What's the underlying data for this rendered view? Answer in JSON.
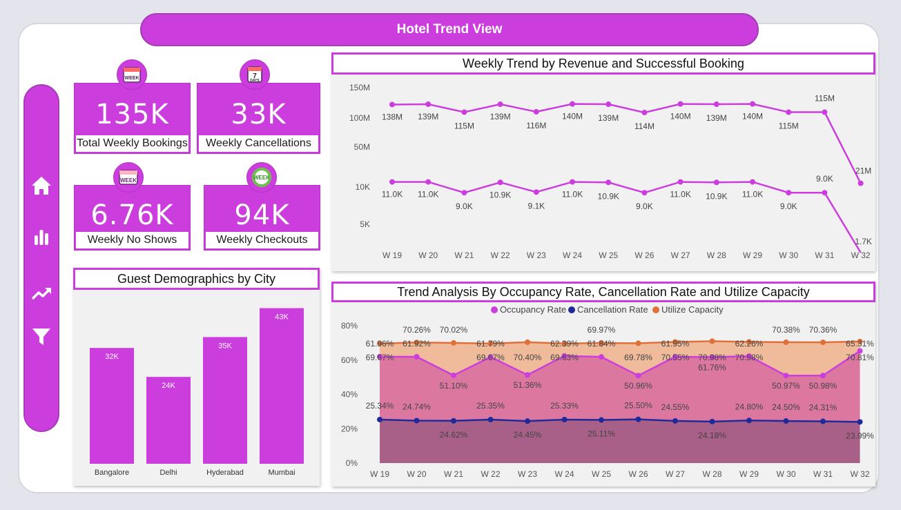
{
  "page_title": "Hotel Trend View",
  "nav": [
    "home-icon",
    "bar-chart-icon",
    "trend-icon",
    "filter-icon"
  ],
  "kpis": [
    {
      "value": "135K",
      "label": "Total Weekly Bookings",
      "icon": "week-calendar-icon"
    },
    {
      "value": "33K",
      "label": "Weekly Cancellations",
      "icon": "seven-days-calendar-icon"
    },
    {
      "value": "6.76K",
      "label": "Weekly No Shows",
      "icon": "week-calendar-icon"
    },
    {
      "value": "94K",
      "label": "Weekly Checkouts",
      "icon": "week-refresh-icon"
    }
  ],
  "colors": {
    "accent": "#cb3ddd",
    "occupancy": "#cb3ddd",
    "cancellation": "#1f2a9a",
    "utilize": "#e0703a"
  },
  "chart_data": [
    {
      "type": "line",
      "title": "Weekly Trend by Revenue and Successful Booking",
      "log_scale": true,
      "grid": false,
      "x": [
        "W 19",
        "W 20",
        "W 21",
        "W 22",
        "W 23",
        "W 24",
        "W 25",
        "W 26",
        "W 27",
        "W 28",
        "W 29",
        "W 30",
        "W 31",
        "W 32"
      ],
      "y_ticks": [
        "150M",
        "100M",
        "50M",
        "10K",
        "5K"
      ],
      "series": [
        {
          "values": [
            138,
            139,
            115,
            139,
            116,
            140,
            139,
            114,
            140,
            139,
            140,
            115,
            115,
            21
          ],
          "labels": [
            "138M",
            "139M",
            "115M",
            "139M",
            "116M",
            "140M",
            "139M",
            "114M",
            "140M",
            "139M",
            "140M",
            "115M",
            "115M",
            "21M"
          ]
        },
        {
          "values": [
            11.0,
            11.0,
            9.0,
            10.9,
            9.1,
            11.0,
            10.9,
            9.0,
            11.0,
            10.9,
            11.0,
            9.0,
            9.0,
            1.7
          ],
          "labels": [
            "11.0K",
            "11.0K",
            "9.0K",
            "10.9K",
            "9.1K",
            "11.0K",
            "10.9K",
            "9.0K",
            "11.0K",
            "10.9K",
            "11.0K",
            "9.0K",
            "9.0K",
            "1.7K"
          ]
        }
      ]
    },
    {
      "type": "bar",
      "title": "Guest Demographics by City",
      "categories": [
        "Bangalore",
        "Delhi",
        "Hyderabad",
        "Mumbai"
      ],
      "values": [
        32,
        24,
        35,
        43
      ],
      "labels": [
        "32K",
        "24K",
        "35K",
        "43K"
      ],
      "ylim": [
        0,
        45
      ]
    },
    {
      "type": "area",
      "title": "Trend Analysis By Occupancy Rate, Cancellation Rate and Utilize Capacity",
      "legend_position": "top",
      "x": [
        "W 19",
        "W 20",
        "W 21",
        "W 22",
        "W 23",
        "W 24",
        "W 25",
        "W 26",
        "W 27",
        "W 28",
        "W 29",
        "W 30",
        "W 31",
        "W 32"
      ],
      "y_ticks": [
        "80%",
        "60%",
        "40%",
        "20%",
        "0%"
      ],
      "ylim": [
        0,
        80
      ],
      "series": [
        {
          "name": "Occupancy Rate",
          "values": [
            61.96,
            61.92,
            51.1,
            61.79,
            51.36,
            62.39,
            61.84,
            50.96,
            61.95,
            61.76,
            62.26,
            50.97,
            50.98,
            65.31
          ],
          "labels": [
            "61.96%",
            "61.92%",
            "51.10%",
            "61.79%",
            "51.36%",
            "62.39%",
            "61.84%",
            "50.96%",
            "61.95%",
            "61.76%",
            "62.26%",
            "50.97%",
            "50.98%",
            "65.31%"
          ]
        },
        {
          "name": "Cancellation Rate",
          "values": [
            25.34,
            24.74,
            24.62,
            25.35,
            24.45,
            25.33,
            25.11,
            25.5,
            24.55,
            24.18,
            24.8,
            24.5,
            24.31,
            23.99
          ],
          "labels": [
            "25.34%",
            "24.74%",
            "24.62%",
            "25.35%",
            "24.45%",
            "25.33%",
            "25.11%",
            "25.50%",
            "24.55%",
            "24.18%",
            "24.80%",
            "24.50%",
            "24.31%",
            "23.99%"
          ]
        },
        {
          "name": "Utilize Capacity",
          "values": [
            69.67,
            70.26,
            70.02,
            69.67,
            70.4,
            69.63,
            69.97,
            69.78,
            70.55,
            70.98,
            70.58,
            70.38,
            70.36,
            70.81
          ],
          "labels": [
            "69.67%",
            "70.26%",
            "70.02%",
            "69.67%",
            "70.40%",
            "69.63%",
            "69.97%",
            "69.78%",
            "70.55%",
            "70.98%",
            "70.58%",
            "70.38%",
            "70.36%",
            "70.81%"
          ]
        }
      ]
    }
  ]
}
